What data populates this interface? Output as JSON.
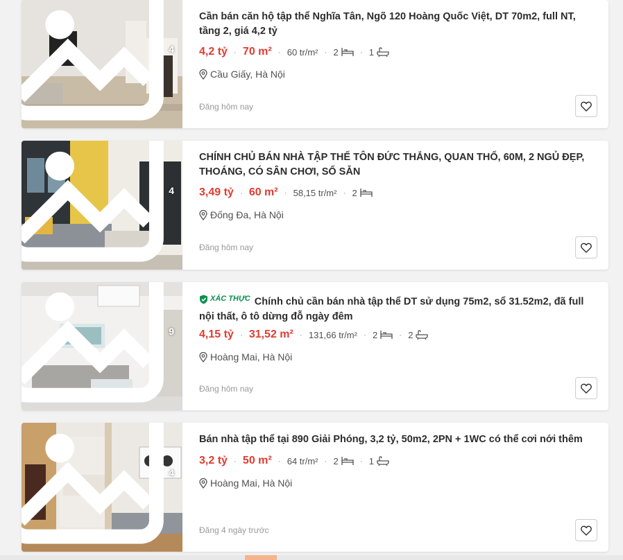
{
  "listings": [
    {
      "title": "Cần bán căn hộ tập thể Nghĩa Tân, Ngõ 120 Hoàng Quốc Việt, DT 70m2, full NT, tầng 2, giá 4,2 tỷ",
      "verified": false,
      "price": "4,2 tỷ",
      "area": "70 m²",
      "price_per_m2": "60 tr/m²",
      "bedrooms": "2",
      "bathrooms": "1",
      "location": "Cầu Giấy, Hà Nội",
      "posted": "Đăng hôm nay",
      "photo_count": "4"
    },
    {
      "title": "CHÍNH CHỦ BÁN NHÀ TẬP THỂ TÔN ĐỨC THẮNG, QUAN THỔ, 60M, 2 NGỦ ĐẸP, THOÁNG, CÓ SÂN CHƠI, SỔ SẴN",
      "verified": false,
      "price": "3,49 tỷ",
      "area": "60 m²",
      "price_per_m2": "58,15 tr/m²",
      "bedrooms": "2",
      "bathrooms": null,
      "location": "Đống Đa, Hà Nội",
      "posted": "Đăng hôm nay",
      "photo_count": "4"
    },
    {
      "title": "Chính chủ cần bán nhà tập thể DT sử dụng 75m2, sổ 31.52m2, đã full nội thất, ô tô dừng đỗ ngày đêm",
      "verified": true,
      "verified_label": "XÁC THỰC",
      "price": "4,15 tỷ",
      "area": "31,52 m²",
      "price_per_m2": "131,66 tr/m²",
      "bedrooms": "2",
      "bathrooms": "2",
      "location": "Hoàng Mai, Hà Nội",
      "posted": "Đăng hôm nay",
      "photo_count": "9"
    },
    {
      "title": "Bán nhà tập thể tại 890 Giải Phóng, 3,2 tỷ, 50m2, 2PN + 1WC có thể cơi nới thêm",
      "verified": false,
      "price": "3,2 tỷ",
      "area": "50 m²",
      "price_per_m2": "64 tr/m²",
      "bedrooms": "2",
      "bathrooms": "1",
      "location": "Hoàng Mai, Hà Nội",
      "posted": "Đăng 4 ngày trước",
      "photo_count": "4"
    }
  ],
  "icons": {
    "gallery": "image-gallery-icon",
    "bed": "bed-icon",
    "bath": "bathtub-icon",
    "location": "map-pin-icon",
    "favorite": "heart-icon",
    "verified": "shield-check-icon"
  },
  "colors": {
    "price": "#e03c31",
    "verified": "#0b8f4f",
    "muted": "#999999"
  }
}
